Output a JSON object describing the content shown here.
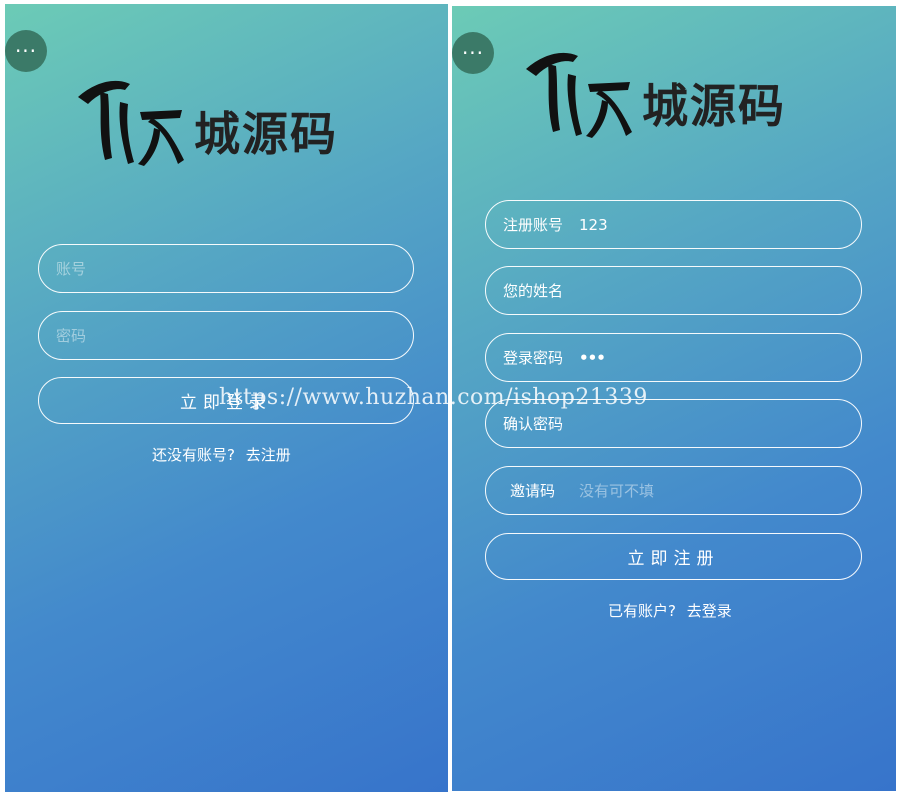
{
  "brand": {
    "logo_text": "城源码"
  },
  "login": {
    "account_placeholder": "账号",
    "password_placeholder": "密码",
    "submit_label": "立即登录",
    "prompt": "还没有账号?",
    "register_link": "去注册"
  },
  "register": {
    "fields": [
      {
        "label": "注册账号",
        "value": "123",
        "placeholder": ""
      },
      {
        "label": "您的姓名",
        "value": "",
        "placeholder": ""
      },
      {
        "label": "登录密码",
        "value": "•••",
        "placeholder": ""
      },
      {
        "label": "确认密码",
        "value": "",
        "placeholder": ""
      },
      {
        "label": "邀请码",
        "value": "",
        "placeholder": "没有可不填"
      }
    ],
    "submit_label": "立即注册",
    "prompt": "已有账户?",
    "login_link": "去登录"
  },
  "watermark": "https://www.huzhan.com/ishop21339",
  "menu_glyph": "···"
}
